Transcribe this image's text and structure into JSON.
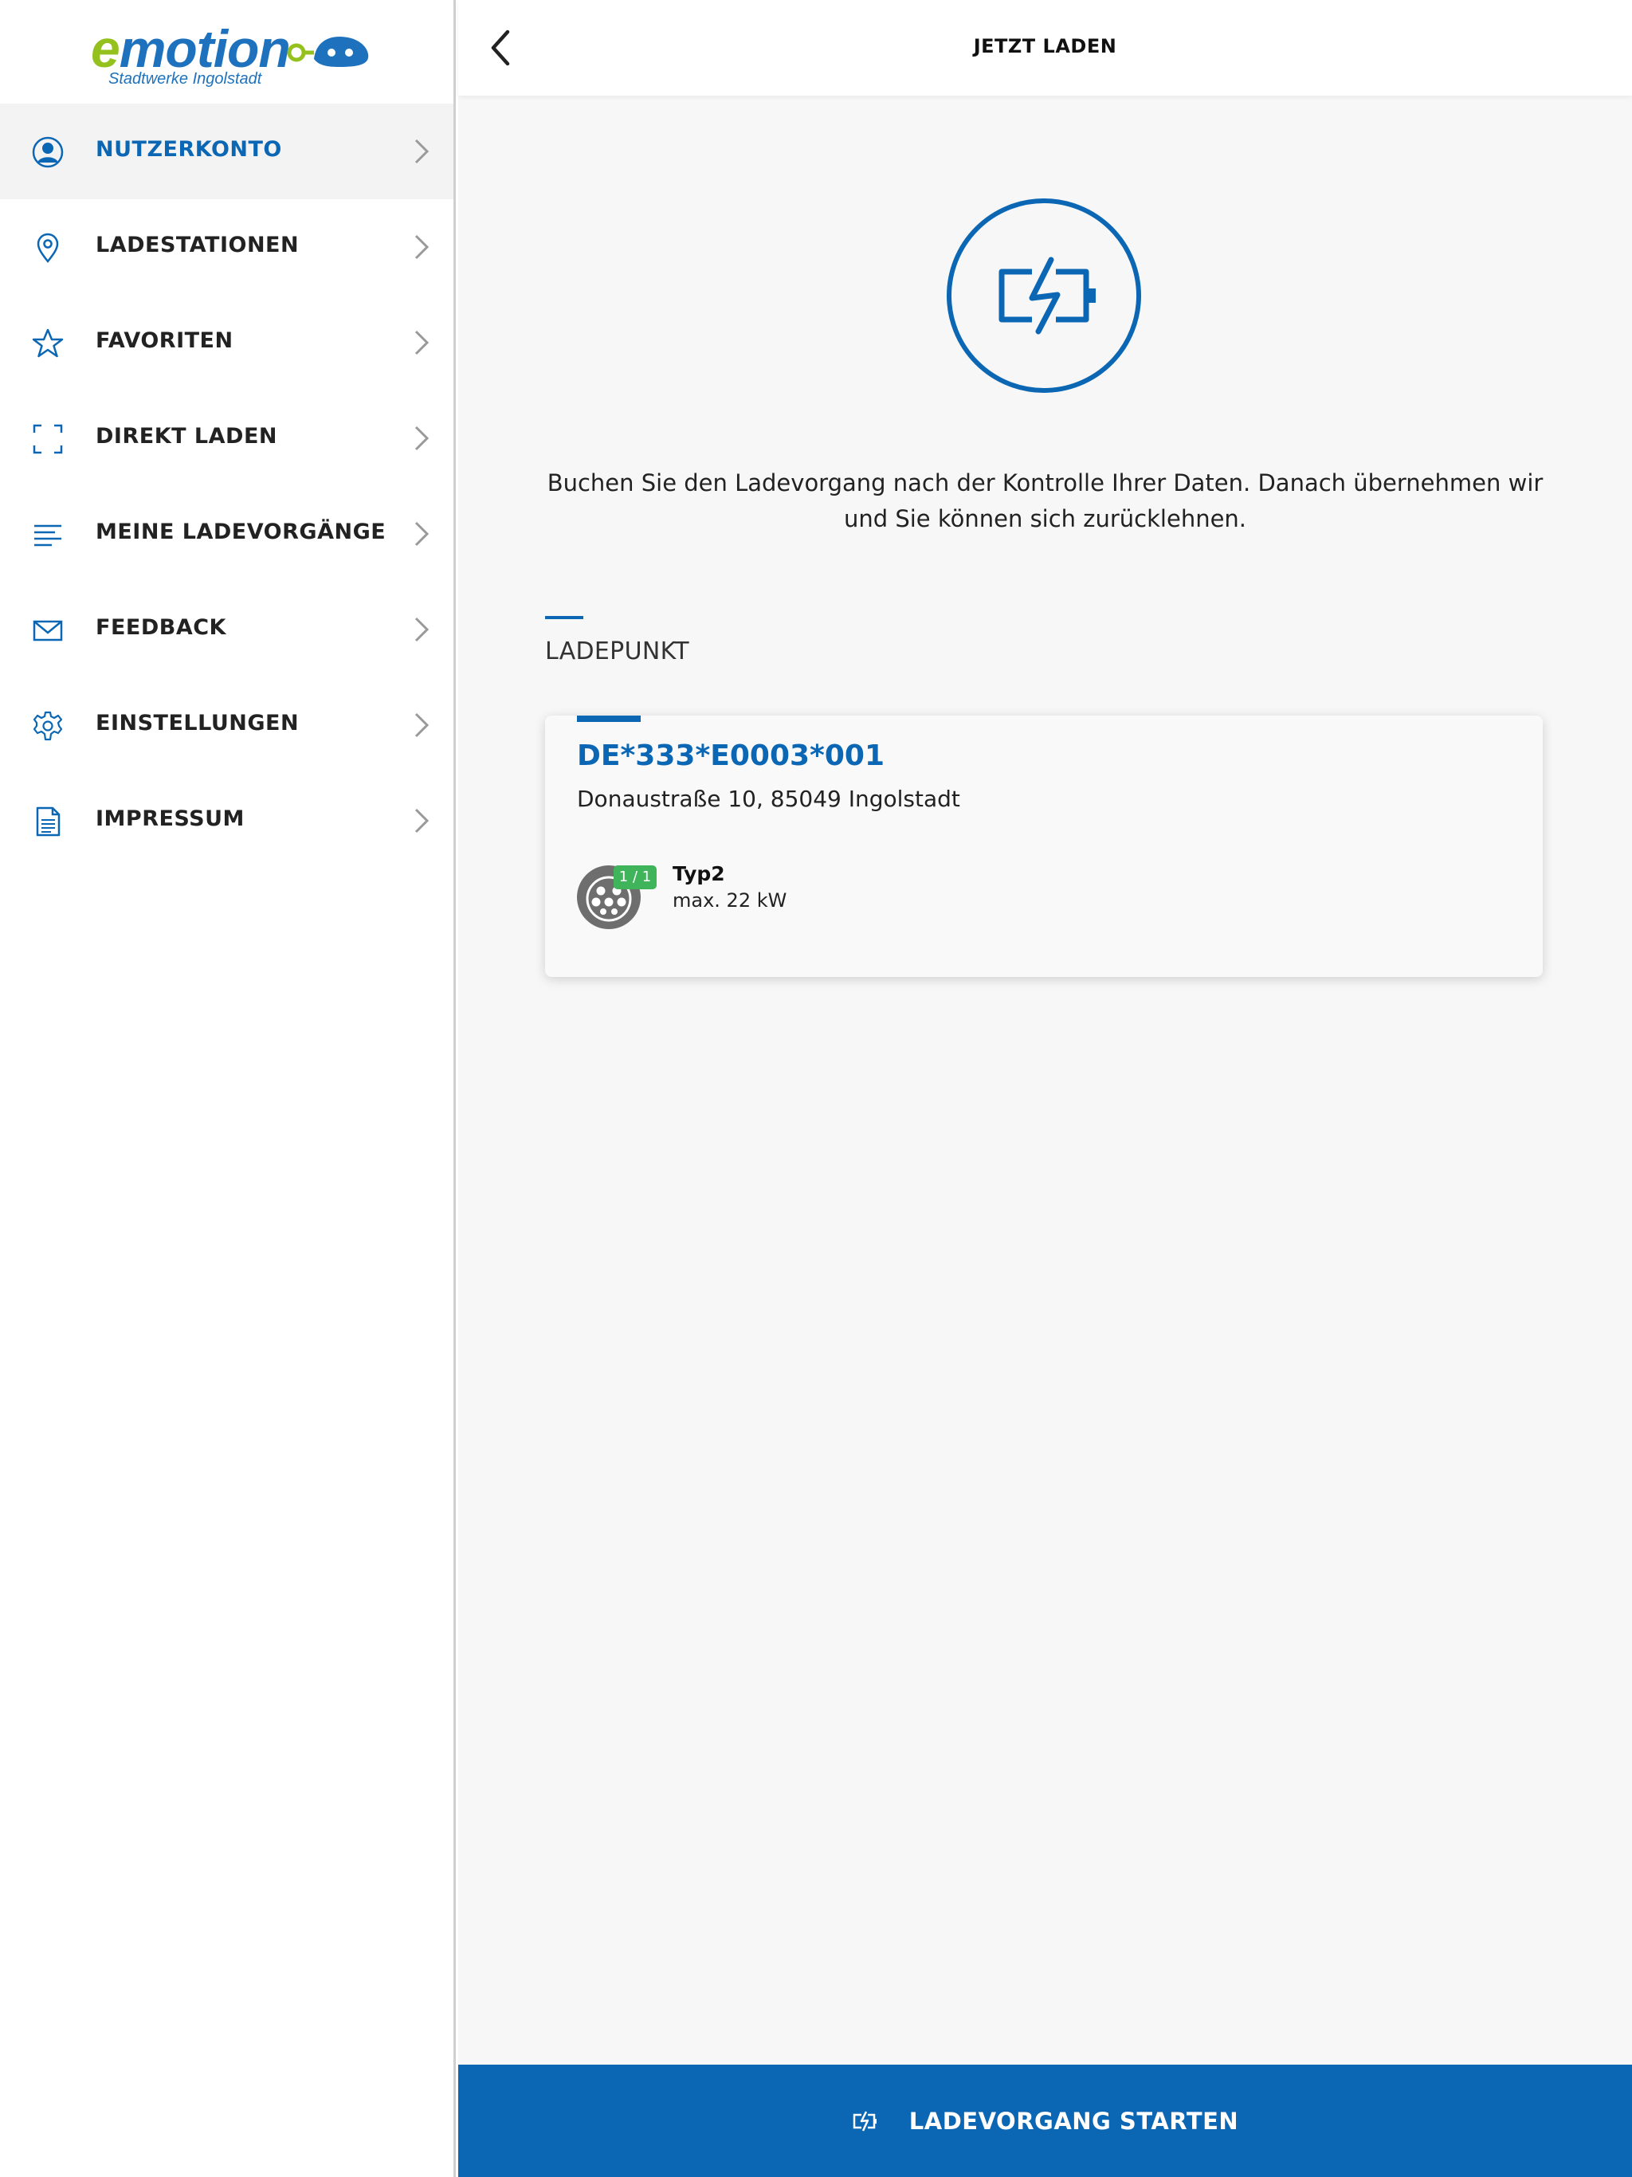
{
  "logo": {
    "wordmark_e": "e",
    "wordmark_rest": "motion",
    "subtitle": "Stadtwerke Ingolstadt"
  },
  "menu": {
    "items": [
      {
        "label": "NUTZERKONTO",
        "icon": "user-icon",
        "active": true
      },
      {
        "label": "LADESTATIONEN",
        "icon": "location-pin-icon",
        "active": false
      },
      {
        "label": "FAVORITEN",
        "icon": "star-icon",
        "active": false
      },
      {
        "label": "DIREKT LADEN",
        "icon": "scan-frame-icon",
        "active": false
      },
      {
        "label": "MEINE LADEVORGÄNGE",
        "icon": "list-icon",
        "active": false
      },
      {
        "label": "FEEDBACK",
        "icon": "mail-icon",
        "active": false
      },
      {
        "label": "EINSTELLUNGEN",
        "icon": "gear-icon",
        "active": false
      },
      {
        "label": "IMPRESSUM",
        "icon": "document-icon",
        "active": false
      }
    ]
  },
  "header": {
    "title": "JETZT LADEN",
    "back_icon": "chevron-left-icon"
  },
  "intro": {
    "text": "Buchen Sie den Ladevorgang nach der Kontrolle Ihrer Daten. Danach übernehmen wir und Sie können sich zurücklehnen."
  },
  "section": {
    "title": "LADEPUNKT"
  },
  "chargepoint": {
    "id": "DE*333*E0003*001",
    "address": "Donaustraße 10, 85049 Ingolstadt",
    "availability": "1 / 1",
    "plug_type": "Typ2",
    "max_power": "max. 22 kW"
  },
  "cta": {
    "label": "LADEVORGANG STARTEN",
    "icon": "charging-battery-icon"
  },
  "colors": {
    "brand_blue": "#0b67b4",
    "logo_green": "#95c11f",
    "available_green": "#3fb45b",
    "plug_gray": "#6e6e6e"
  }
}
